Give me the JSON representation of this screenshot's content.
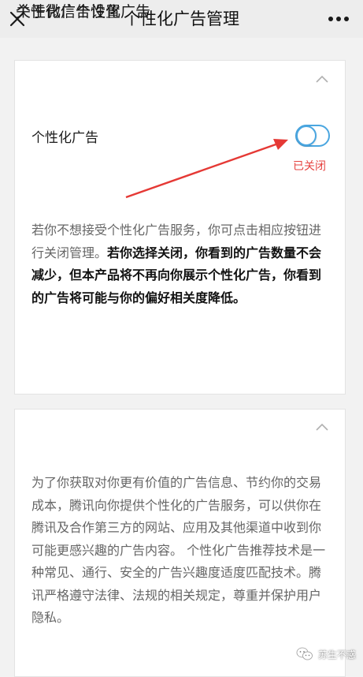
{
  "nav": {
    "title": "个性化广告管理"
  },
  "section_settings": {
    "title": "个性化广告设置",
    "row_label": "个性化广告",
    "toggle_on": false,
    "status_text": "已关闭",
    "desc_normal": "若你不想接受个性化广告服务，你可点击相应按钮进行关闭管理。",
    "desc_bold": "若你选择关闭，你看到的广告数量不会减少，但本产品将不再向你展示个性化广告，你看到的广告将可能与你的偏好相关度降低。"
  },
  "section_about": {
    "title": "关于微信个性化广告",
    "desc": "为了你获取对你更有价值的广告信息、节约你的交易成本，腾讯向你提供个性化的广告服务，可以供你在腾讯及合作第三方的网站、应用及其他渠道中收到你可能更感兴趣的广告内容。 个性化广告推荐技术是一种常见、通行、安全的广告兴趣度适度匹配技术。腾讯严格遵守法律、法规的相关规定，尊重并保护用户隐私。"
  },
  "watermark": {
    "text": "苏生不惑"
  },
  "colors": {
    "accent_blue": "#4aa6e0",
    "status_red": "#e64340",
    "arrow_red": "#e53935",
    "background": "#f2f2f2"
  },
  "icons": {
    "close": "close-icon",
    "more": "more-icon",
    "collapse": "chevron-up-icon",
    "watermark": "wechat-icon"
  }
}
